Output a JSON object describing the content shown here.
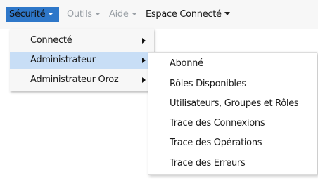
{
  "menubar": {
    "items": [
      {
        "label": "Sécurité",
        "state": "active"
      },
      {
        "label": "Outils",
        "state": "disabled"
      },
      {
        "label": "Aide",
        "state": "disabled"
      },
      {
        "label": "Espace Connecté",
        "state": "normal"
      }
    ]
  },
  "securite_menu": {
    "items": [
      {
        "label": "Connecté",
        "has_submenu": true
      },
      {
        "label": "Administrateur",
        "has_submenu": true,
        "selected": true
      },
      {
        "label": "Administrateur Oroz",
        "has_submenu": true
      }
    ]
  },
  "administrateur_submenu": {
    "items": [
      {
        "label": "Abonné"
      },
      {
        "label": "Rôles Disponibles"
      },
      {
        "label": "Utilisateurs, Groupes et Rôles"
      },
      {
        "label": "Trace des Connexions"
      },
      {
        "label": "Trace des Opérations"
      },
      {
        "label": "Trace des Erreurs"
      }
    ]
  },
  "colors": {
    "active_menu_bg": "#2e77c9",
    "selected_item_bg": "#c8def6",
    "disabled_text": "#9aa0a6",
    "menubar_bg": "#f7f7f7"
  }
}
